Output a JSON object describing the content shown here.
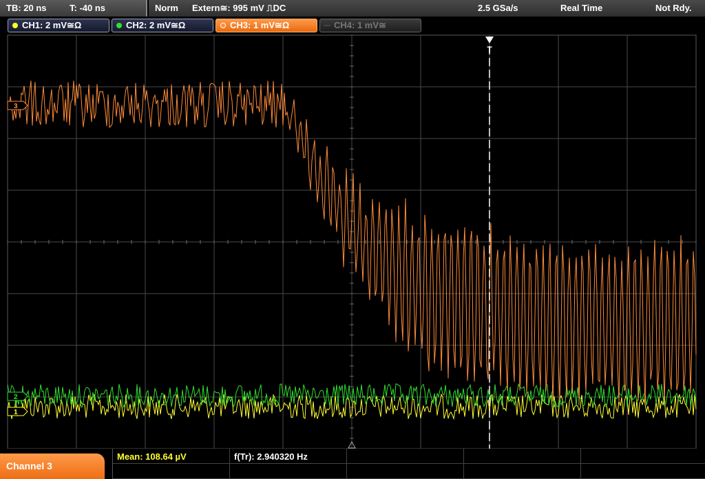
{
  "topbar": {
    "timebase": "TB: 20 ns",
    "trigger_offset": "T: -40 ns",
    "trigger_mode": "Norm",
    "trigger_source": "Extern≅: 995 mV ⎍DC",
    "sample_rate": "2.5 GSa/s",
    "acq_mode": "Real Time",
    "status": "Not Rdy."
  },
  "channels": [
    {
      "label": "CH1: 2 mV≅Ω",
      "color": "#ffff30",
      "state": "on"
    },
    {
      "label": "CH2: 2 mV≅Ω",
      "color": "#30e030",
      "state": "on"
    },
    {
      "label": "CH3: 1 mV≅Ω",
      "color": "#ff8c3a",
      "state": "active"
    },
    {
      "label": "CH4: 1 mV≅",
      "color": "#8a8a8a",
      "state": "off"
    }
  ],
  "markers": {
    "ch3_ref": "3",
    "ch2_ref": "2",
    "ch1_ref": "1",
    "trigger": "T"
  },
  "bottombar": {
    "active_channel": "Channel 3",
    "mean": "Mean: 108.64 µV",
    "frequency": "f(Tr): 2.940320 Hz"
  },
  "colors": {
    "ch1": "#ffff30",
    "ch2": "#30e030",
    "ch3": "#ff8c3a",
    "grid": "#4a4a4a",
    "trigger_line": "#ffffff"
  }
}
